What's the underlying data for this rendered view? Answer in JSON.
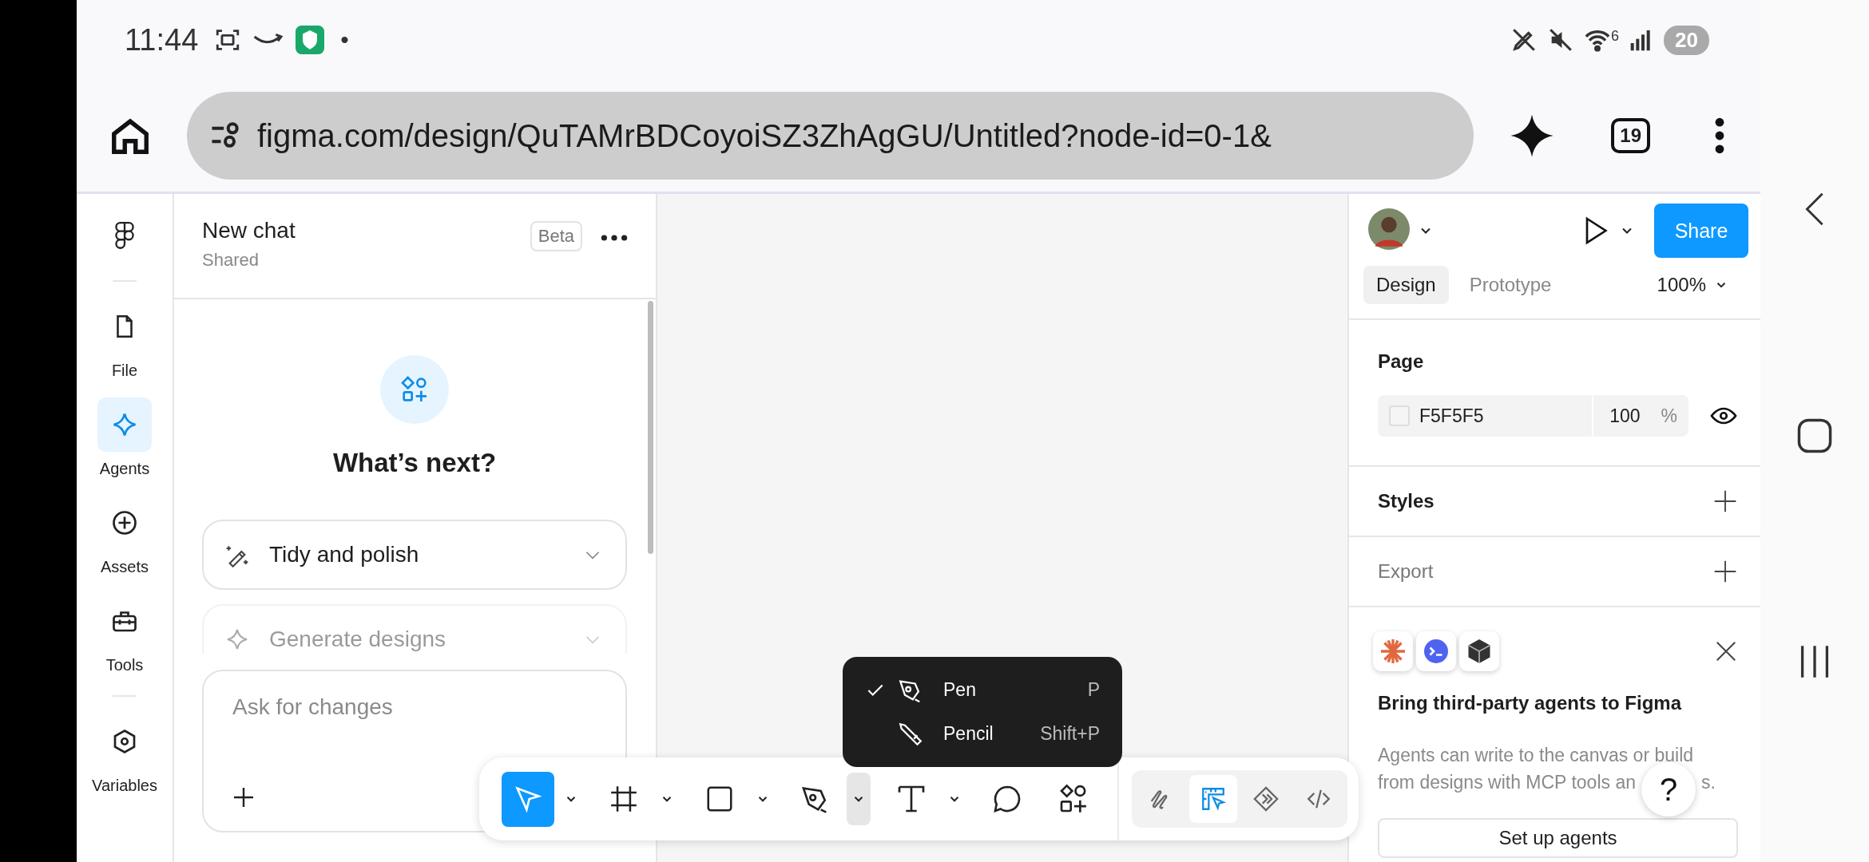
{
  "status_bar": {
    "time": "11:44",
    "dot": "•",
    "wifi_badge": "6",
    "battery": "20"
  },
  "browser": {
    "url": "figma.com/design/QuTAMrBDCoyoiSZ3ZhAgGU/Untitled?node-id=0-1&",
    "tab_count": "19"
  },
  "rail": {
    "items": [
      {
        "label": "File",
        "kind": "file",
        "selected": false
      },
      {
        "label": "Agents",
        "kind": "agents",
        "selected": true
      },
      {
        "label": "Assets",
        "kind": "assets",
        "selected": false
      },
      {
        "label": "Tools",
        "kind": "tools",
        "selected": false
      },
      {
        "label": "Variables",
        "kind": "variables",
        "selected": false
      }
    ]
  },
  "chat": {
    "title": "New chat",
    "subtitle": "Shared",
    "badge": "Beta",
    "heading": "What’s next?",
    "suggestions": [
      {
        "label": "Tidy and polish",
        "kind": "wand",
        "faded": false
      },
      {
        "label": "Generate designs",
        "kind": "sparkle",
        "faded": true
      }
    ],
    "input": {
      "placeholder": "Ask for changes"
    }
  },
  "toolbar": {
    "tools": [
      {
        "kind": "move",
        "selected": true,
        "menu_open": false
      },
      {
        "kind": "frame",
        "selected": false,
        "menu_open": false
      },
      {
        "kind": "rectangle",
        "selected": false,
        "menu_open": false
      },
      {
        "kind": "pen",
        "selected": false,
        "menu_open": true
      },
      {
        "kind": "text",
        "selected": false,
        "menu_open": false
      },
      {
        "kind": "comment",
        "selected": false
      },
      {
        "kind": "actions",
        "selected": false
      }
    ],
    "modes": [
      {
        "kind": "draw",
        "selected": false
      },
      {
        "kind": "design",
        "selected": true
      },
      {
        "kind": "prototype",
        "selected": false
      },
      {
        "kind": "dev",
        "selected": false
      }
    ]
  },
  "tool_menu": {
    "items": [
      {
        "label": "Pen",
        "shortcut": "P",
        "checked": true,
        "kind": "pen"
      },
      {
        "label": "Pencil",
        "shortcut": "Shift+P",
        "checked": false,
        "kind": "pencil"
      }
    ]
  },
  "properties": {
    "share": "Share",
    "tabs": [
      {
        "label": "Design",
        "selected": true
      },
      {
        "label": "Prototype",
        "selected": false
      }
    ],
    "zoom": "100%",
    "page": {
      "title": "Page",
      "color": "F5F5F5",
      "opacity": "100",
      "unit": "%"
    },
    "sections": [
      {
        "title": "Styles",
        "muted": false
      },
      {
        "title": "Export",
        "muted": true
      }
    ],
    "promo": {
      "title": "Bring third-party agents to Figma",
      "lines": [
        "Agents can write to the canvas or build",
        "from designs with MCP tools an"
      ],
      "tail": "s.",
      "button": "Set up agents"
    }
  },
  "help": "?"
}
